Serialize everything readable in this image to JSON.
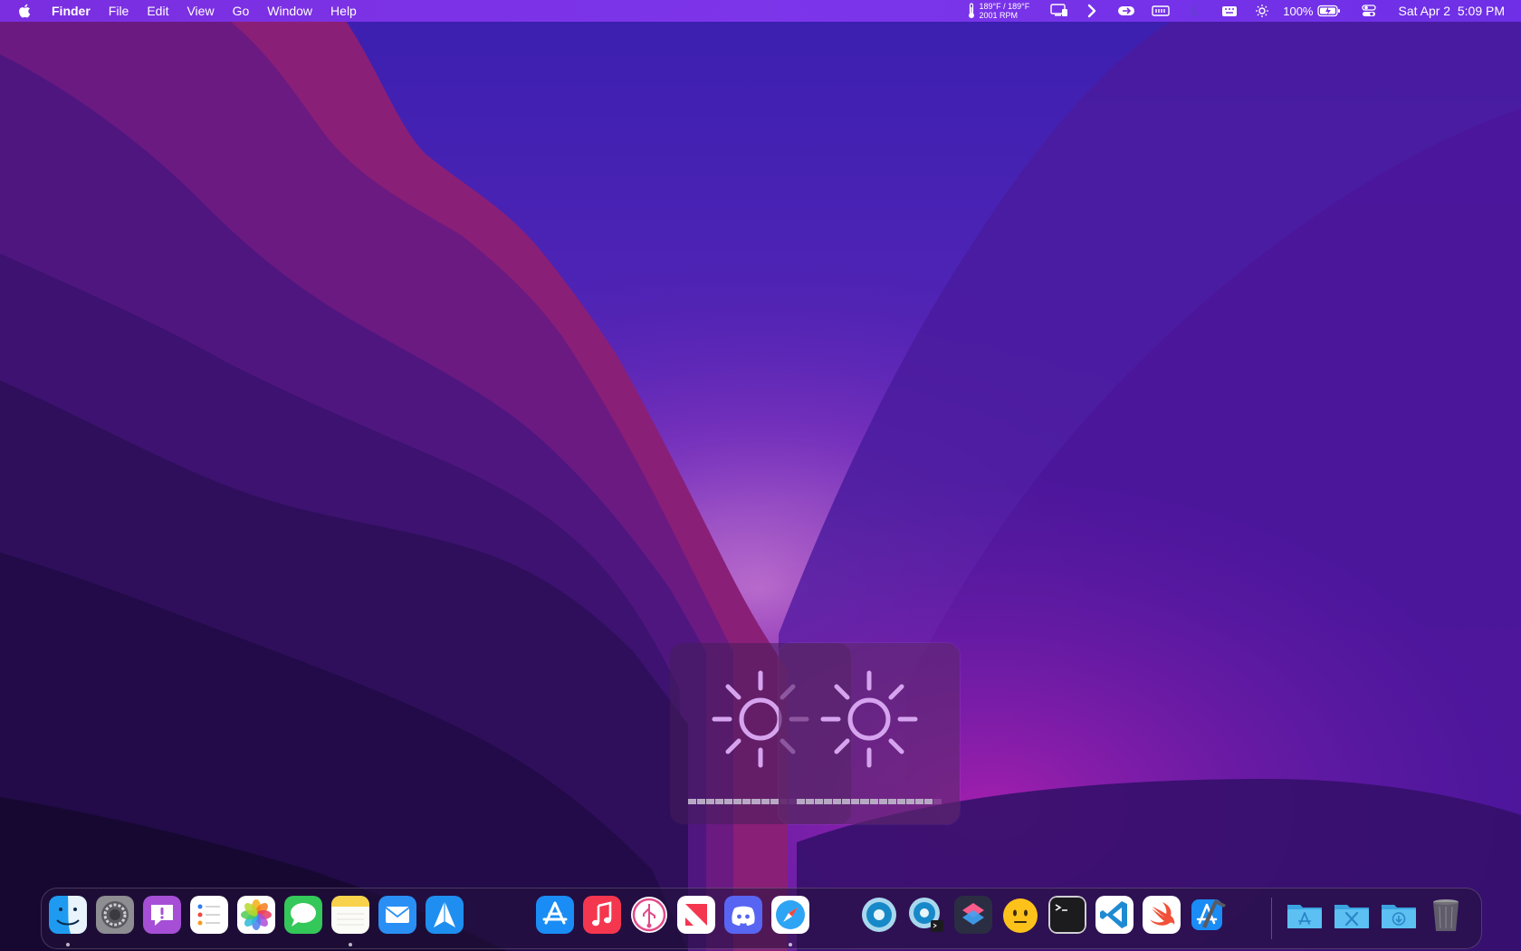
{
  "menubar": {
    "app_name": "Finder",
    "menus": [
      "File",
      "Edit",
      "View",
      "Go",
      "Window",
      "Help"
    ],
    "temperature": "189°F / 189°F",
    "fan_speed": "2001 RPM",
    "battery_percent": "100%",
    "date": "Sat Apr 2",
    "time": "5:09 PM",
    "tray_icons": [
      "thermometer-icon",
      "display-icon",
      "chevron-right-icon",
      "cloud-sync-icon",
      "memory-icon",
      "moon-icon",
      "keyboard-icon",
      "brightness-icon",
      "battery-icon",
      "control-center-icon"
    ]
  },
  "brightness_hud": {
    "level_back": 0.65,
    "level_front": 0.94
  },
  "dock": {
    "apps": [
      {
        "name": "Finder",
        "icon": "finder-icon",
        "running": true
      },
      {
        "name": "System Preferences",
        "icon": "settings-gear-icon",
        "running": false
      },
      {
        "name": "Feedback Assistant",
        "icon": "feedback-icon",
        "running": false
      },
      {
        "name": "Reminders",
        "icon": "reminders-icon",
        "running": false
      },
      {
        "name": "Photos",
        "icon": "photos-icon",
        "running": false
      },
      {
        "name": "Messages",
        "icon": "messages-icon",
        "running": false
      },
      {
        "name": "Notes",
        "icon": "notes-icon",
        "running": true
      },
      {
        "name": "Mail",
        "icon": "mail-icon",
        "running": false
      },
      {
        "name": "Spark",
        "icon": "paper-plane-icon",
        "running": false
      },
      {
        "name": "App Store",
        "icon": "app-store-icon",
        "running": false
      },
      {
        "name": "Music",
        "icon": "music-icon",
        "running": false
      },
      {
        "name": "System Information",
        "icon": "usb-icon",
        "running": false
      },
      {
        "name": "News",
        "icon": "news-icon",
        "running": false
      },
      {
        "name": "Discord",
        "icon": "discord-icon",
        "running": false
      },
      {
        "name": "Safari",
        "icon": "compass-icon",
        "running": true
      },
      {
        "name": "Disk Utility",
        "icon": "disk-icon",
        "running": false
      },
      {
        "name": "Disk Utility Console",
        "icon": "disk-console-icon",
        "running": false
      },
      {
        "name": "Shortcuts",
        "icon": "shortcuts-icon",
        "running": false
      },
      {
        "name": "Emoji",
        "icon": "emoji-face-icon",
        "running": false
      },
      {
        "name": "Terminal",
        "icon": "terminal-icon",
        "running": false
      },
      {
        "name": "Visual Studio Code",
        "icon": "vscode-icon",
        "running": false
      },
      {
        "name": "Swift Playgrounds",
        "icon": "swift-icon",
        "running": false
      },
      {
        "name": "Xcode",
        "icon": "xcode-hammer-icon",
        "running": false
      },
      {
        "name": "Applications",
        "icon": "applications-folder-icon",
        "running": false
      },
      {
        "name": "Utilities",
        "icon": "utilities-folder-icon",
        "running": false
      },
      {
        "name": "Downloads",
        "icon": "downloads-folder-icon",
        "running": false
      },
      {
        "name": "Trash",
        "icon": "trash-icon",
        "running": false
      }
    ]
  },
  "colors": {
    "menubar_bg": "#7a2ee0",
    "hud_tint": "#d6a4ef",
    "folder_blue": "#4fb8f0"
  }
}
